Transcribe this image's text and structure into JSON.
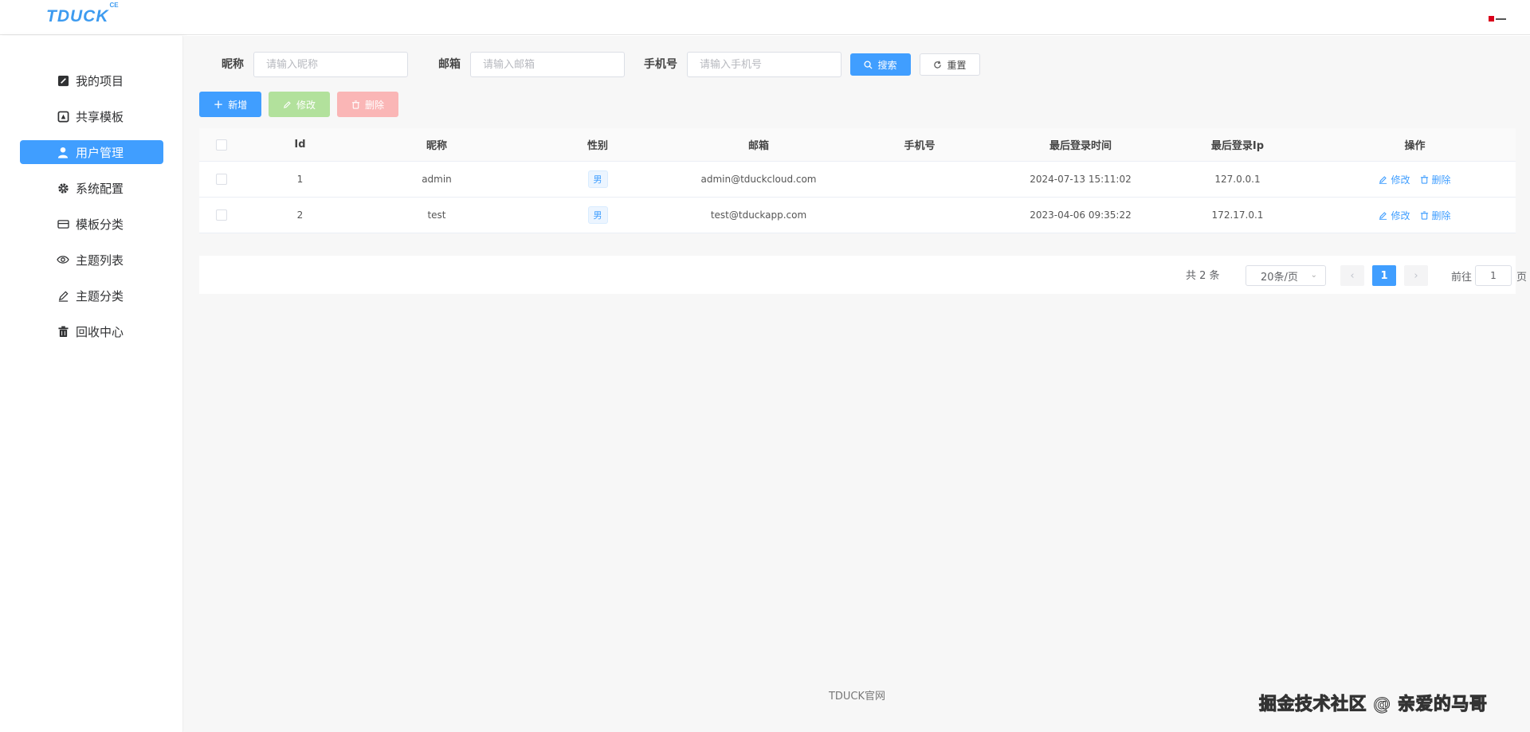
{
  "app": {
    "logo_text": "TDUCK",
    "logo_sup": "CE"
  },
  "sidebar": {
    "items": [
      {
        "label": "我的项目",
        "icon": "edit-square-icon",
        "active": false
      },
      {
        "label": "共享模板",
        "icon": "template-icon",
        "active": false
      },
      {
        "label": "用户管理",
        "icon": "user-icon",
        "active": true
      },
      {
        "label": "系统配置",
        "icon": "gear-icon",
        "active": false
      },
      {
        "label": "模板分类",
        "icon": "card-icon",
        "active": false
      },
      {
        "label": "主题列表",
        "icon": "eye-icon",
        "active": false
      },
      {
        "label": "主题分类",
        "icon": "pen-icon",
        "active": false
      },
      {
        "label": "回收中心",
        "icon": "trash-icon",
        "active": false
      }
    ]
  },
  "filters": {
    "nickname_label": "昵称",
    "nickname_placeholder": "请输入昵称",
    "email_label": "邮箱",
    "email_placeholder": "请输入邮箱",
    "phone_label": "手机号",
    "phone_placeholder": "请输入手机号",
    "search_label": "搜索",
    "reset_label": "重置"
  },
  "toolbar": {
    "add_label": "新增",
    "edit_label": "修改",
    "delete_label": "删除"
  },
  "table": {
    "columns": [
      "Id",
      "昵称",
      "性别",
      "邮箱",
      "手机号",
      "最后登录时间",
      "最后登录Ip",
      "操作"
    ],
    "rows": [
      {
        "id": "1",
        "nickname": "admin",
        "gender": "男",
        "email": "admin@tduckcloud.com",
        "phone": "",
        "last_login_time": "2024-07-13 15:11:02",
        "last_login_ip": "127.0.0.1"
      },
      {
        "id": "2",
        "nickname": "test",
        "gender": "男",
        "email": "test@tduckapp.com",
        "phone": "",
        "last_login_time": "2023-04-06 09:35:22",
        "last_login_ip": "172.17.0.1"
      }
    ],
    "row_edit_label": "修改",
    "row_delete_label": "删除"
  },
  "pagination": {
    "total_text": "共 2 条",
    "page_size": "20条/页",
    "current_page": "1",
    "goto_label": "前往",
    "goto_value": "1",
    "goto_suffix": "页"
  },
  "footer": {
    "link_text": "TDUCK官网"
  },
  "watermark": "掘金技术社区 @ 亲爱的马哥",
  "colors": {
    "primary": "#409eff",
    "success_disabled": "#b2e19c",
    "danger_disabled": "#fab6b6",
    "logo": "#3d9bf0"
  }
}
